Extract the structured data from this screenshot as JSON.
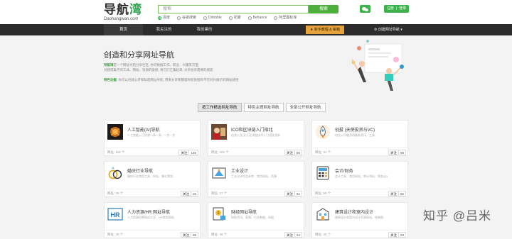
{
  "logo": {
    "main_a": "导航",
    "main_b": "湾",
    "sub": "Daohangwan.com"
  },
  "search": {
    "placeholder": "搜索",
    "button": "搜索"
  },
  "engines": [
    "百度",
    "谷歌搜索",
    "Dribbble",
    "花瓣",
    "Behance",
    "阿里图标库"
  ],
  "header": {
    "login": "注册",
    "register": "登录"
  },
  "nav": {
    "items": [
      "首页",
      "我关注的",
      "我创建的"
    ],
    "recommend": "新手教程 & 秘籍",
    "create": "创建网址导航"
  },
  "hero": {
    "title": "创造和分享网址导航",
    "line1_key": "导航湾",
    "line1": "是一个网址导航分享社区, 你可根据工作、职业、兴趣等方面",
    "line2": "创建或集齐的工具、网站、资源的链接, 将它们汇集起来, 分享给有需要的朋友",
    "line3_key": "特色功能",
    "line3": ": 你可以创建公开和私密网址导航, 用来分享和整理导航链接和不可对外展示的网站链接"
  },
  "tabs": [
    "按工作精选网址导航",
    "特色主题网址导航",
    "全部公开网址导航"
  ],
  "cards": [
    {
      "title": "人工智能(AI)导航",
      "desc": "人工智能入门资源一条一条...一步一步",
      "count": "网址: 116 个",
      "follow": "关注",
      "followers": "145",
      "icon": "ai-icon"
    },
    {
      "title": "ICO和区块链入门指北",
      "desc": "由浅入深,关于区块链技术入门相关资料",
      "count": "网址: 102 个",
      "follow": "关注",
      "followers": "80",
      "icon": "blockchain-icon"
    },
    {
      "title": "创投 (天使投资与VC)",
      "desc": "创业公司融资的最新资讯、工具",
      "count": "网址: 31 个",
      "follow": "关注",
      "followers": "88",
      "icon": "rocket-icon"
    },
    {
      "title": "婚庆行业导航",
      "desc": "婚庆行业常用工具、网站、婚礼策划...",
      "count": "网址: 26 个",
      "follow": "关注",
      "followers": "26",
      "icon": "rings-icon"
    },
    {
      "title": "工业设计",
      "desc": "工业设计作品参考、常用网站、资源",
      "count": "网址: 27 个",
      "follow": "关注",
      "followers": "81",
      "icon": "industrial-icon"
    },
    {
      "title": "会计/财务",
      "desc": "会计工具、常用网站、审计资料、税务QQ",
      "count": "网址: 50 个",
      "follow": "关注",
      "followers": "56",
      "icon": "finance-icon"
    },
    {
      "title": "人力资源/HR 网址导航",
      "desc": "人力资源招聘网站大全、HR常用网站",
      "count": "网址: 49 个",
      "follow": "关注",
      "followers": "68",
      "icon": "hr-icon"
    },
    {
      "title": "财经网址导航",
      "desc": "财经资讯、股票、行业数据、研报",
      "count": "网址: 46 个",
      "follow": "关注",
      "followers": "94",
      "icon": "money-icon"
    },
    {
      "title": "建筑设计和室内设计",
      "desc": "建筑设计和室内设计资源网站、效果图",
      "count": "网址: 45 个",
      "follow": "关注",
      "followers": "93",
      "icon": "building-icon"
    }
  ],
  "watermark": "知乎 @吕米"
}
